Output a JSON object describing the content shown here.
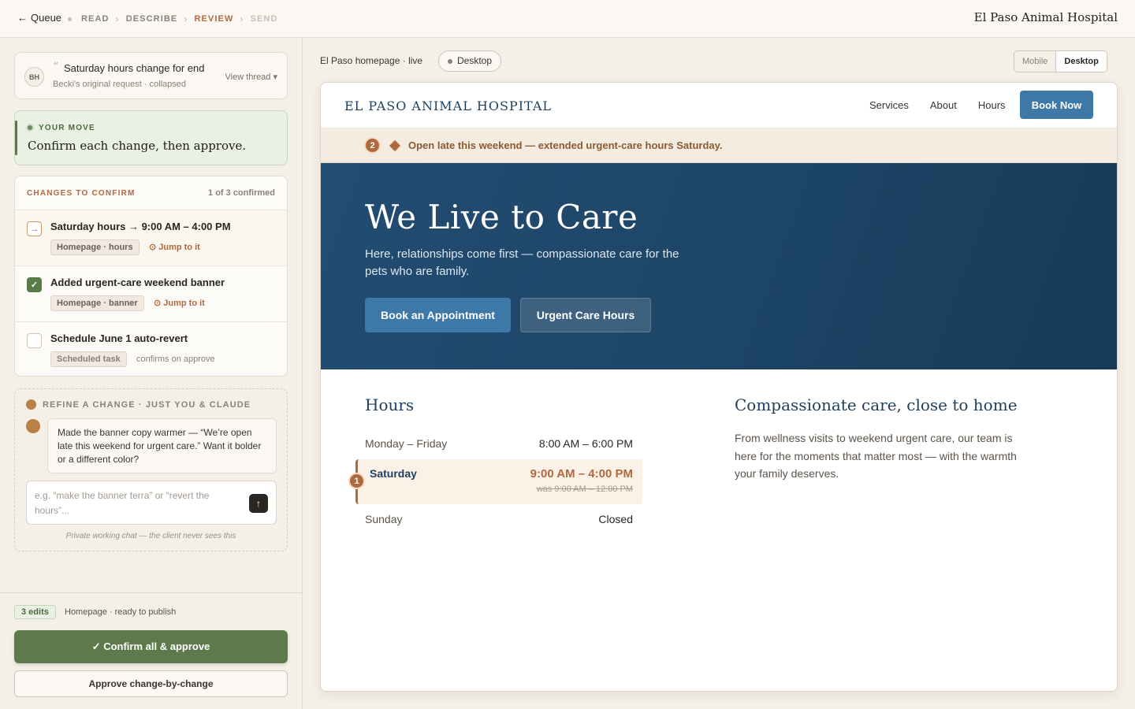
{
  "topbar": {
    "back_label": "Queue",
    "steps": [
      "READ",
      "DESCRIBE",
      "REVIEW",
      "SEND"
    ],
    "brand": "El Paso Animal Hospital"
  },
  "thread": {
    "initials": "BH",
    "title": "Saturday hours change for end",
    "subtitle": "Becki's original request · collapsed",
    "view_label": "View thread ▾"
  },
  "your_move": {
    "label": "YOUR MOVE",
    "text": "Confirm each change, then approve."
  },
  "changes": {
    "title": "CHANGES TO CONFIRM",
    "count": "1 of 3 confirmed",
    "items": [
      {
        "title": "Saturday hours → 9:00 AM – 4:00 PM",
        "tag": "Homepage · hours",
        "jump": "⊙ Jump to it",
        "state": "pending"
      },
      {
        "title": "Added urgent-care weekend banner",
        "tag": "Homepage · banner",
        "jump": "⊙ Jump to it",
        "state": "confirmed"
      },
      {
        "title": "Schedule June 1 auto-revert",
        "tag": "Scheduled task",
        "note": "confirms on approve",
        "state": "unchecked"
      }
    ]
  },
  "refine": {
    "title": "REFINE A CHANGE · JUST YOU & CLAUDE",
    "message": "Made the banner copy warmer — “We’re open late this weekend for urgent care.” Want it bolder or a different color?",
    "placeholder": "e.g. “make the banner terra” or “revert the hours”...",
    "private_note": "Private working chat — the client never sees this"
  },
  "footer": {
    "edits_badge": "3 edits",
    "edits_note": "Homepage · ready to publish",
    "primary_label": "✓ Confirm all & approve",
    "secondary_label": "Approve change-by-change"
  },
  "preview": {
    "label": "El Paso homepage · live",
    "device_pill": "Desktop",
    "toggle": [
      "Mobile",
      "Desktop"
    ]
  },
  "site": {
    "logo": "EL PASO ANIMAL HOSPITAL",
    "nav": [
      "Services",
      "About",
      "Hours"
    ],
    "book_now": "Book Now",
    "banner_marker": "2",
    "banner_text": "Open late this weekend — extended urgent-care hours Saturday.",
    "hero_title": "We Live to Care",
    "hero_sub": "Here, relationships come first — compassionate care for the pets who are family.",
    "hero_btn_primary": "Book an Appointment",
    "hero_btn_secondary": "Urgent Care Hours",
    "hours_title": "Hours",
    "hours": [
      {
        "day": "Monday – Friday",
        "time": "8:00 AM – 6:00 PM"
      },
      {
        "day": "Saturday",
        "time": "9:00 AM – 4:00 PM",
        "was": "was 9:00 AM – 12:00 PM"
      },
      {
        "day": "Sunday",
        "time": "Closed"
      }
    ],
    "saturday_marker": "1",
    "care_title": "Compassionate care, close to home",
    "care_text": "From wellness visits to weekend urgent care, our team is here for the moments that matter most — with the warmth your family deserves."
  },
  "colors": {
    "accent_terra": "#b0693d",
    "approve_green": "#5e7a4d",
    "site_navy": "#1d3f5e",
    "site_blue": "#3e78a6"
  }
}
